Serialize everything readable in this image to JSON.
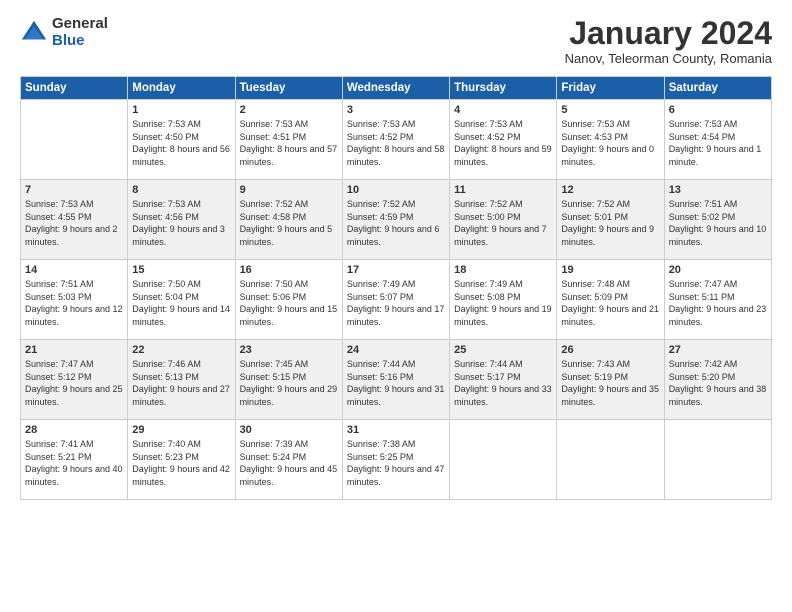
{
  "logo": {
    "general": "General",
    "blue": "Blue"
  },
  "title": "January 2024",
  "subtitle": "Nanov, Teleorman County, Romania",
  "days_header": [
    "Sunday",
    "Monday",
    "Tuesday",
    "Wednesday",
    "Thursday",
    "Friday",
    "Saturday"
  ],
  "weeks": [
    [
      {
        "day": "",
        "info": ""
      },
      {
        "day": "1",
        "info": "Sunrise: 7:53 AM\nSunset: 4:50 PM\nDaylight: 8 hours\nand 56 minutes."
      },
      {
        "day": "2",
        "info": "Sunrise: 7:53 AM\nSunset: 4:51 PM\nDaylight: 8 hours\nand 57 minutes."
      },
      {
        "day": "3",
        "info": "Sunrise: 7:53 AM\nSunset: 4:52 PM\nDaylight: 8 hours\nand 58 minutes."
      },
      {
        "day": "4",
        "info": "Sunrise: 7:53 AM\nSunset: 4:52 PM\nDaylight: 8 hours\nand 59 minutes."
      },
      {
        "day": "5",
        "info": "Sunrise: 7:53 AM\nSunset: 4:53 PM\nDaylight: 9 hours\nand 0 minutes."
      },
      {
        "day": "6",
        "info": "Sunrise: 7:53 AM\nSunset: 4:54 PM\nDaylight: 9 hours\nand 1 minute."
      }
    ],
    [
      {
        "day": "7",
        "info": "Sunrise: 7:53 AM\nSunset: 4:55 PM\nDaylight: 9 hours\nand 2 minutes."
      },
      {
        "day": "8",
        "info": "Sunrise: 7:53 AM\nSunset: 4:56 PM\nDaylight: 9 hours\nand 3 minutes."
      },
      {
        "day": "9",
        "info": "Sunrise: 7:52 AM\nSunset: 4:58 PM\nDaylight: 9 hours\nand 5 minutes."
      },
      {
        "day": "10",
        "info": "Sunrise: 7:52 AM\nSunset: 4:59 PM\nDaylight: 9 hours\nand 6 minutes."
      },
      {
        "day": "11",
        "info": "Sunrise: 7:52 AM\nSunset: 5:00 PM\nDaylight: 9 hours\nand 7 minutes."
      },
      {
        "day": "12",
        "info": "Sunrise: 7:52 AM\nSunset: 5:01 PM\nDaylight: 9 hours\nand 9 minutes."
      },
      {
        "day": "13",
        "info": "Sunrise: 7:51 AM\nSunset: 5:02 PM\nDaylight: 9 hours\nand 10 minutes."
      }
    ],
    [
      {
        "day": "14",
        "info": "Sunrise: 7:51 AM\nSunset: 5:03 PM\nDaylight: 9 hours\nand 12 minutes."
      },
      {
        "day": "15",
        "info": "Sunrise: 7:50 AM\nSunset: 5:04 PM\nDaylight: 9 hours\nand 14 minutes."
      },
      {
        "day": "16",
        "info": "Sunrise: 7:50 AM\nSunset: 5:06 PM\nDaylight: 9 hours\nand 15 minutes."
      },
      {
        "day": "17",
        "info": "Sunrise: 7:49 AM\nSunset: 5:07 PM\nDaylight: 9 hours\nand 17 minutes."
      },
      {
        "day": "18",
        "info": "Sunrise: 7:49 AM\nSunset: 5:08 PM\nDaylight: 9 hours\nand 19 minutes."
      },
      {
        "day": "19",
        "info": "Sunrise: 7:48 AM\nSunset: 5:09 PM\nDaylight: 9 hours\nand 21 minutes."
      },
      {
        "day": "20",
        "info": "Sunrise: 7:47 AM\nSunset: 5:11 PM\nDaylight: 9 hours\nand 23 minutes."
      }
    ],
    [
      {
        "day": "21",
        "info": "Sunrise: 7:47 AM\nSunset: 5:12 PM\nDaylight: 9 hours\nand 25 minutes."
      },
      {
        "day": "22",
        "info": "Sunrise: 7:46 AM\nSunset: 5:13 PM\nDaylight: 9 hours\nand 27 minutes."
      },
      {
        "day": "23",
        "info": "Sunrise: 7:45 AM\nSunset: 5:15 PM\nDaylight: 9 hours\nand 29 minutes."
      },
      {
        "day": "24",
        "info": "Sunrise: 7:44 AM\nSunset: 5:16 PM\nDaylight: 9 hours\nand 31 minutes."
      },
      {
        "day": "25",
        "info": "Sunrise: 7:44 AM\nSunset: 5:17 PM\nDaylight: 9 hours\nand 33 minutes."
      },
      {
        "day": "26",
        "info": "Sunrise: 7:43 AM\nSunset: 5:19 PM\nDaylight: 9 hours\nand 35 minutes."
      },
      {
        "day": "27",
        "info": "Sunrise: 7:42 AM\nSunset: 5:20 PM\nDaylight: 9 hours\nand 38 minutes."
      }
    ],
    [
      {
        "day": "28",
        "info": "Sunrise: 7:41 AM\nSunset: 5:21 PM\nDaylight: 9 hours\nand 40 minutes."
      },
      {
        "day": "29",
        "info": "Sunrise: 7:40 AM\nSunset: 5:23 PM\nDaylight: 9 hours\nand 42 minutes."
      },
      {
        "day": "30",
        "info": "Sunrise: 7:39 AM\nSunset: 5:24 PM\nDaylight: 9 hours\nand 45 minutes."
      },
      {
        "day": "31",
        "info": "Sunrise: 7:38 AM\nSunset: 5:25 PM\nDaylight: 9 hours\nand 47 minutes."
      },
      {
        "day": "",
        "info": ""
      },
      {
        "day": "",
        "info": ""
      },
      {
        "day": "",
        "info": ""
      }
    ]
  ]
}
